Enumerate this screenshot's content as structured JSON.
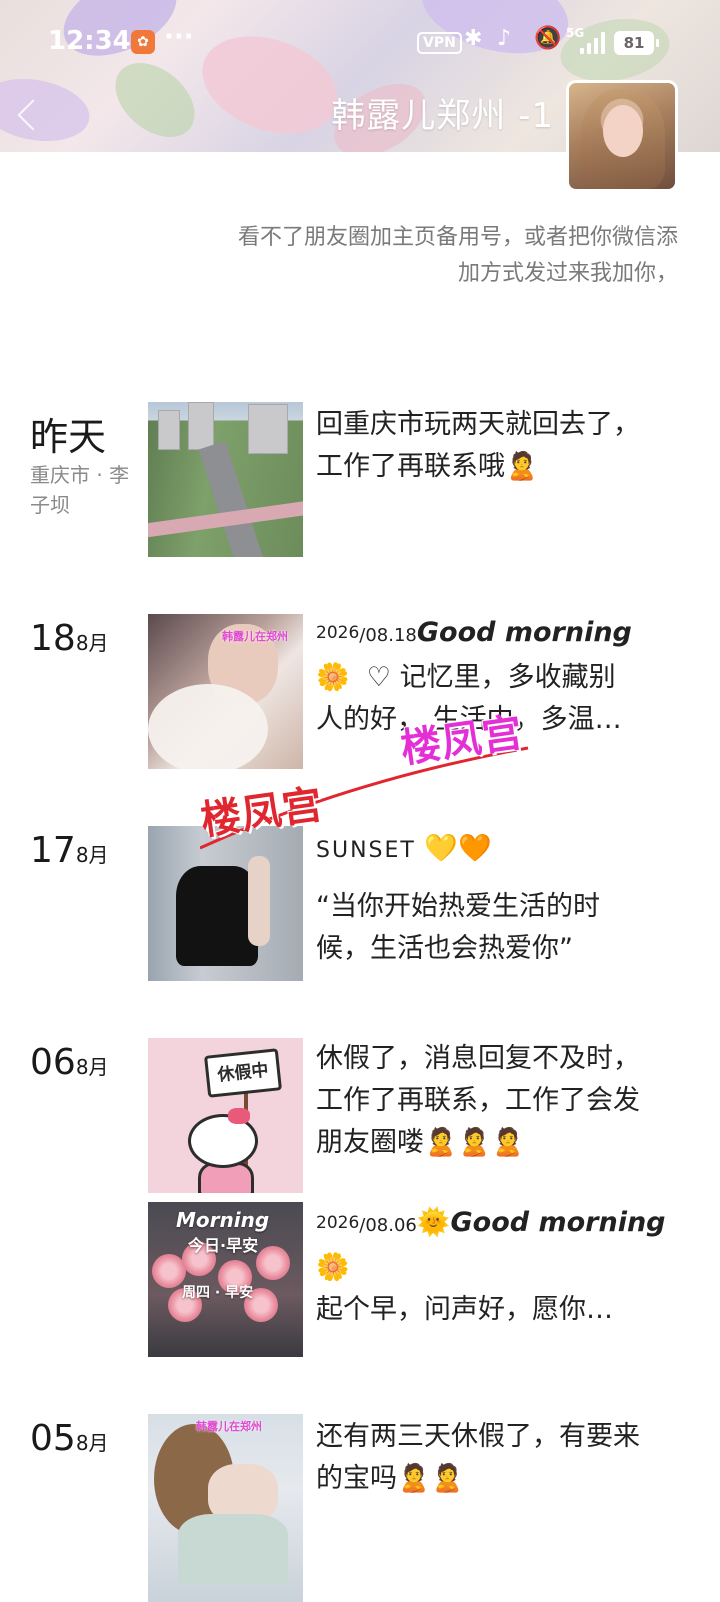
{
  "status_bar": {
    "time": "12:34",
    "more": "···",
    "vpn": "VPN",
    "network": "5G",
    "battery": "81"
  },
  "profile": {
    "name": "韩露儿郑州 -1",
    "signature_line1": "看不了朋友圈加主页备用号，或者把你微信添",
    "signature_line2": "加方式发过来我加你，"
  },
  "watermark": "楼凤宫",
  "posts": [
    {
      "day_label": "昨天",
      "location": "重庆市 · 李子坝",
      "text_line1": "回重庆市玩两天就回去了，",
      "text_line2": "工作了再联系哦",
      "emoji": "🙎"
    },
    {
      "day": "18",
      "month": "8月",
      "year_super": "2026",
      "date_rest": "/08.18",
      "headline": "Good morning",
      "line2_emoji": "🌼",
      "line2": "♡ 记忆里，多收藏别",
      "line3": "人的好，  生活中，多温…",
      "thumb_label": "韩露儿在郑州"
    },
    {
      "day": "17",
      "month": "8月",
      "title": "SUNSET",
      "hearts": "💛🧡",
      "quote_line1": "“当你开始热爱生活的时",
      "quote_line2": "候，生活也会热爱你”"
    },
    {
      "day": "06",
      "month": "8月",
      "line1": "休假了，消息回复不及时，",
      "line2": "工作了再联系，工作了会发",
      "line3": "朋友圈喽",
      "emojis": "🙎🙎🙎",
      "sign_text": "休假中"
    },
    {
      "year_super": "2026",
      "date_rest": "/08.06",
      "sun": "🌞",
      "headline": "Good morning",
      "line2_emoji": "🌼",
      "line3": "起个早，问声好，愿你…",
      "thumb_title": "Morning",
      "thumb_sub": "今日·早安",
      "thumb_day": "周四 · 早安"
    },
    {
      "day": "05",
      "month": "8月",
      "line1": "还有两三天休假了，有要来",
      "line2": "的宝吗",
      "emojis": "🙎🙎",
      "thumb_label": "韩露儿在郑州"
    }
  ]
}
